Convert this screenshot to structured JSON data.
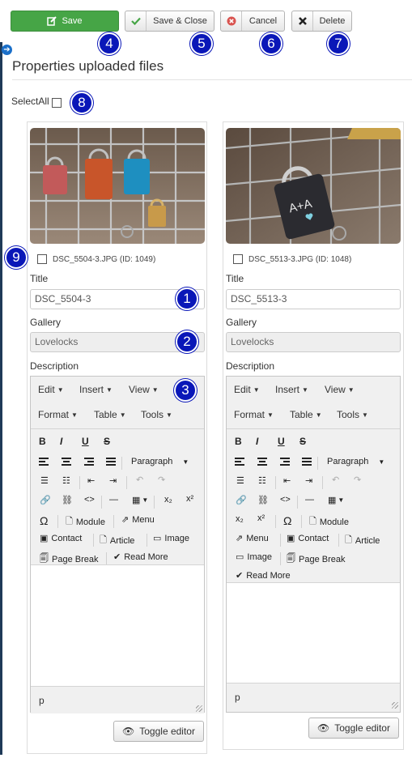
{
  "toolbar": {
    "save": "Save",
    "save_close": "Save & Close",
    "cancel": "Cancel",
    "delete": "Delete"
  },
  "page": {
    "title": "Properties uploaded files",
    "select_all": "SelectAll"
  },
  "badges": [
    "1",
    "2",
    "3",
    "4",
    "5",
    "6",
    "7",
    "8",
    "9"
  ],
  "files": [
    {
      "filename": "DSC_5504-3.JPG (ID: 1049)",
      "title_label": "Title",
      "title_value": "DSC_5504-3",
      "gallery_label": "Gallery",
      "gallery_value": "Lovelocks",
      "description_label": "Description",
      "toggle_label": "Toggle editor",
      "status_path": "p"
    },
    {
      "filename": "DSC_5513-3.JPG (ID: 1048)",
      "title_label": "Title",
      "title_value": "DSC_5513-3",
      "gallery_label": "Gallery",
      "gallery_value": "Lovelocks",
      "description_label": "Description",
      "toggle_label": "Toggle editor",
      "status_path": "p"
    }
  ],
  "editor": {
    "menus": [
      "Edit",
      "Insert",
      "View",
      "Format",
      "Table",
      "Tools"
    ],
    "format_select": "Paragraph",
    "buttons": {
      "module": "Module",
      "menu": "Menu",
      "contact": "Contact",
      "article": "Article",
      "image": "Image",
      "page_break": "Page Break",
      "read_more": "Read More"
    }
  },
  "colors": {
    "save_green": "#46a546",
    "badge_blue": "#0a17b8",
    "cancel_red": "#d9534f"
  }
}
